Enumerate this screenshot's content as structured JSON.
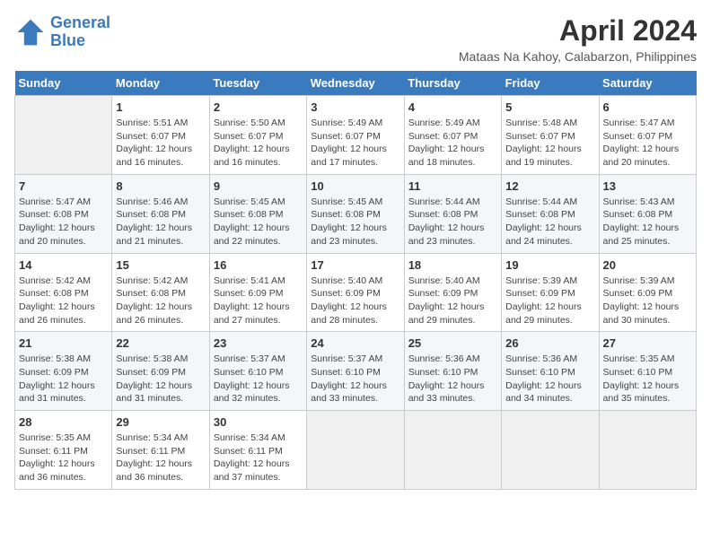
{
  "header": {
    "logo_line1": "General",
    "logo_line2": "Blue",
    "month": "April 2024",
    "location": "Mataas Na Kahoy, Calabarzon, Philippines"
  },
  "days_of_week": [
    "Sunday",
    "Monday",
    "Tuesday",
    "Wednesday",
    "Thursday",
    "Friday",
    "Saturday"
  ],
  "weeks": [
    [
      {
        "num": "",
        "sunrise": "",
        "sunset": "",
        "daylight": ""
      },
      {
        "num": "1",
        "sunrise": "5:51 AM",
        "sunset": "6:07 PM",
        "daylight": "12 hours and 16 minutes."
      },
      {
        "num": "2",
        "sunrise": "5:50 AM",
        "sunset": "6:07 PM",
        "daylight": "12 hours and 16 minutes."
      },
      {
        "num": "3",
        "sunrise": "5:49 AM",
        "sunset": "6:07 PM",
        "daylight": "12 hours and 17 minutes."
      },
      {
        "num": "4",
        "sunrise": "5:49 AM",
        "sunset": "6:07 PM",
        "daylight": "12 hours and 18 minutes."
      },
      {
        "num": "5",
        "sunrise": "5:48 AM",
        "sunset": "6:07 PM",
        "daylight": "12 hours and 19 minutes."
      },
      {
        "num": "6",
        "sunrise": "5:47 AM",
        "sunset": "6:07 PM",
        "daylight": "12 hours and 20 minutes."
      }
    ],
    [
      {
        "num": "7",
        "sunrise": "5:47 AM",
        "sunset": "6:08 PM",
        "daylight": "12 hours and 20 minutes."
      },
      {
        "num": "8",
        "sunrise": "5:46 AM",
        "sunset": "6:08 PM",
        "daylight": "12 hours and 21 minutes."
      },
      {
        "num": "9",
        "sunrise": "5:45 AM",
        "sunset": "6:08 PM",
        "daylight": "12 hours and 22 minutes."
      },
      {
        "num": "10",
        "sunrise": "5:45 AM",
        "sunset": "6:08 PM",
        "daylight": "12 hours and 23 minutes."
      },
      {
        "num": "11",
        "sunrise": "5:44 AM",
        "sunset": "6:08 PM",
        "daylight": "12 hours and 23 minutes."
      },
      {
        "num": "12",
        "sunrise": "5:44 AM",
        "sunset": "6:08 PM",
        "daylight": "12 hours and 24 minutes."
      },
      {
        "num": "13",
        "sunrise": "5:43 AM",
        "sunset": "6:08 PM",
        "daylight": "12 hours and 25 minutes."
      }
    ],
    [
      {
        "num": "14",
        "sunrise": "5:42 AM",
        "sunset": "6:08 PM",
        "daylight": "12 hours and 26 minutes."
      },
      {
        "num": "15",
        "sunrise": "5:42 AM",
        "sunset": "6:08 PM",
        "daylight": "12 hours and 26 minutes."
      },
      {
        "num": "16",
        "sunrise": "5:41 AM",
        "sunset": "6:09 PM",
        "daylight": "12 hours and 27 minutes."
      },
      {
        "num": "17",
        "sunrise": "5:40 AM",
        "sunset": "6:09 PM",
        "daylight": "12 hours and 28 minutes."
      },
      {
        "num": "18",
        "sunrise": "5:40 AM",
        "sunset": "6:09 PM",
        "daylight": "12 hours and 29 minutes."
      },
      {
        "num": "19",
        "sunrise": "5:39 AM",
        "sunset": "6:09 PM",
        "daylight": "12 hours and 29 minutes."
      },
      {
        "num": "20",
        "sunrise": "5:39 AM",
        "sunset": "6:09 PM",
        "daylight": "12 hours and 30 minutes."
      }
    ],
    [
      {
        "num": "21",
        "sunrise": "5:38 AM",
        "sunset": "6:09 PM",
        "daylight": "12 hours and 31 minutes."
      },
      {
        "num": "22",
        "sunrise": "5:38 AM",
        "sunset": "6:09 PM",
        "daylight": "12 hours and 31 minutes."
      },
      {
        "num": "23",
        "sunrise": "5:37 AM",
        "sunset": "6:10 PM",
        "daylight": "12 hours and 32 minutes."
      },
      {
        "num": "24",
        "sunrise": "5:37 AM",
        "sunset": "6:10 PM",
        "daylight": "12 hours and 33 minutes."
      },
      {
        "num": "25",
        "sunrise": "5:36 AM",
        "sunset": "6:10 PM",
        "daylight": "12 hours and 33 minutes."
      },
      {
        "num": "26",
        "sunrise": "5:36 AM",
        "sunset": "6:10 PM",
        "daylight": "12 hours and 34 minutes."
      },
      {
        "num": "27",
        "sunrise": "5:35 AM",
        "sunset": "6:10 PM",
        "daylight": "12 hours and 35 minutes."
      }
    ],
    [
      {
        "num": "28",
        "sunrise": "5:35 AM",
        "sunset": "6:11 PM",
        "daylight": "12 hours and 36 minutes."
      },
      {
        "num": "29",
        "sunrise": "5:34 AM",
        "sunset": "6:11 PM",
        "daylight": "12 hours and 36 minutes."
      },
      {
        "num": "30",
        "sunrise": "5:34 AM",
        "sunset": "6:11 PM",
        "daylight": "12 hours and 37 minutes."
      },
      {
        "num": "",
        "sunrise": "",
        "sunset": "",
        "daylight": ""
      },
      {
        "num": "",
        "sunrise": "",
        "sunset": "",
        "daylight": ""
      },
      {
        "num": "",
        "sunrise": "",
        "sunset": "",
        "daylight": ""
      },
      {
        "num": "",
        "sunrise": "",
        "sunset": "",
        "daylight": ""
      }
    ]
  ]
}
